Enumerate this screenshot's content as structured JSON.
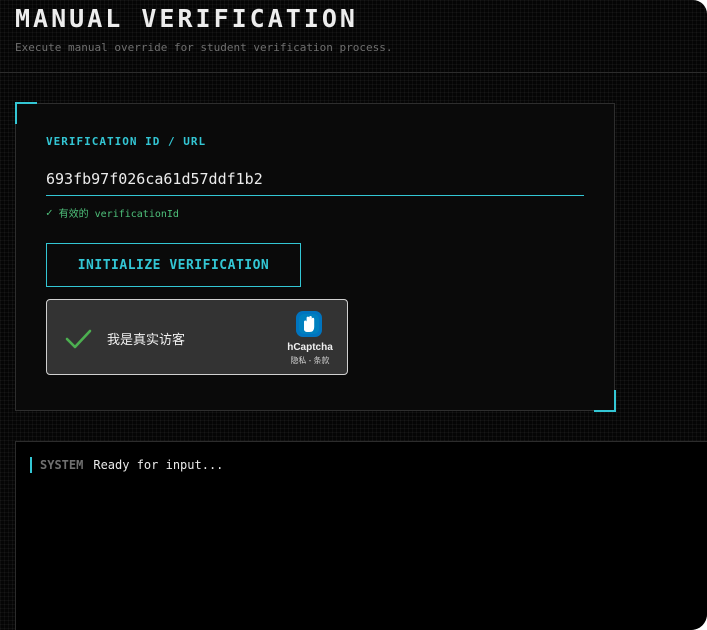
{
  "header": {
    "title": "MANUAL VERIFICATION",
    "subtitle": "Execute manual override for student verification process."
  },
  "form": {
    "field_label": "VERIFICATION ID / URL",
    "id_value": "693fb97f026ca61d57ddf1b2",
    "validation_icon": "check-icon",
    "validation_mark": "✓",
    "validation_text": "有效的 verificationId",
    "submit_label": "INITIALIZE VERIFICATION"
  },
  "captcha": {
    "label": "我是真实访客",
    "brand": "hCaptcha",
    "links": "隐私 - 条款",
    "checked": true
  },
  "console": {
    "tag": "SYSTEM",
    "message": "Ready for input..."
  },
  "colors": {
    "accent": "#33c6d4",
    "success": "#4ec07a",
    "background": "#050505"
  }
}
